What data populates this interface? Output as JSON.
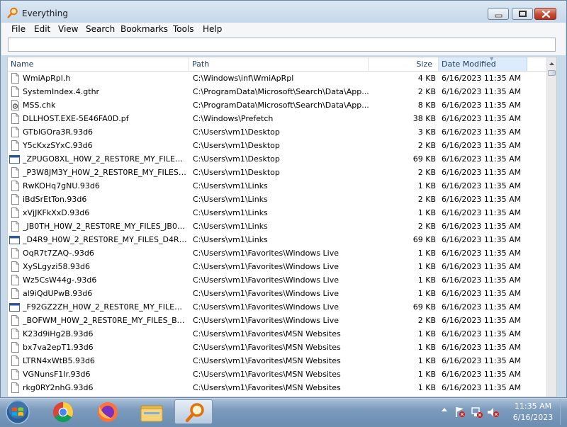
{
  "window": {
    "title": "Everything"
  },
  "menu": [
    "File",
    "Edit",
    "View",
    "Search",
    "Bookmarks",
    "Tools",
    "Help"
  ],
  "search": {
    "value": ""
  },
  "columns": {
    "name": "Name",
    "path": "Path",
    "size": "Size",
    "date": "Date Modified"
  },
  "files": [
    {
      "icon": "doc",
      "name": "WmiApRpl.h",
      "path": "C:\\Windows\\inf\\WmiApRpl",
      "size": "4 KB",
      "date": "6/16/2023 11:35 AM"
    },
    {
      "icon": "doc",
      "name": "SystemIndex.4.gthr",
      "path": "C:\\ProgramData\\Microsoft\\Search\\Data\\App...",
      "size": "2 KB",
      "date": "6/16/2023 11:35 AM"
    },
    {
      "icon": "gear",
      "name": "MSS.chk",
      "path": "C:\\ProgramData\\Microsoft\\Search\\Data\\App...",
      "size": "8 KB",
      "date": "6/16/2023 11:35 AM"
    },
    {
      "icon": "doc",
      "name": "DLLHOST.EXE-5E46FA0D.pf",
      "path": "C:\\Windows\\Prefetch",
      "size": "38 KB",
      "date": "6/16/2023 11:35 AM"
    },
    {
      "icon": "doc",
      "name": "GTblGOra3R.93d6",
      "path": "C:\\Users\\vm1\\Desktop",
      "size": "3 KB",
      "date": "6/16/2023 11:35 AM"
    },
    {
      "icon": "doc",
      "name": "Y5cKxzSYxC.93d6",
      "path": "C:\\Users\\vm1\\Desktop",
      "size": "2 KB",
      "date": "6/16/2023 11:35 AM"
    },
    {
      "icon": "window",
      "name": "_ZPUGO8XL_H0W_2_REST0RE_MY_FILES_Z...",
      "path": "C:\\Users\\vm1\\Desktop",
      "size": "69 KB",
      "date": "6/16/2023 11:35 AM"
    },
    {
      "icon": "doc",
      "name": "_P3W8JM3Y_H0W_2_REST0RE_MY_FILES_P...",
      "path": "C:\\Users\\vm1\\Desktop",
      "size": "2 KB",
      "date": "6/16/2023 11:35 AM"
    },
    {
      "icon": "doc",
      "name": "RwKOHq7gNU.93d6",
      "path": "C:\\Users\\vm1\\Links",
      "size": "1 KB",
      "date": "6/16/2023 11:35 AM"
    },
    {
      "icon": "doc",
      "name": "iBdSrEtTon.93d6",
      "path": "C:\\Users\\vm1\\Links",
      "size": "2 KB",
      "date": "6/16/2023 11:35 AM"
    },
    {
      "icon": "doc",
      "name": "xVjJKFkXxD.93d6",
      "path": "C:\\Users\\vm1\\Links",
      "size": "1 KB",
      "date": "6/16/2023 11:35 AM"
    },
    {
      "icon": "doc",
      "name": "_JB0TH_H0W_2_REST0RE_MY_FILES_JB0TH...",
      "path": "C:\\Users\\vm1\\Links",
      "size": "2 KB",
      "date": "6/16/2023 11:35 AM"
    },
    {
      "icon": "window",
      "name": "_D4R9_H0W_2_REST0RE_MY_FILES_D4R9_...",
      "path": "C:\\Users\\vm1\\Links",
      "size": "69 KB",
      "date": "6/16/2023 11:35 AM"
    },
    {
      "icon": "doc",
      "name": "OqR7t7ZAQ-.93d6",
      "path": "C:\\Users\\vm1\\Favorites\\Windows Live",
      "size": "1 KB",
      "date": "6/16/2023 11:35 AM"
    },
    {
      "icon": "doc",
      "name": "XySLgyzi58.93d6",
      "path": "C:\\Users\\vm1\\Favorites\\Windows Live",
      "size": "1 KB",
      "date": "6/16/2023 11:35 AM"
    },
    {
      "icon": "doc",
      "name": "Wz5CsW44g-.93d6",
      "path": "C:\\Users\\vm1\\Favorites\\Windows Live",
      "size": "1 KB",
      "date": "6/16/2023 11:35 AM"
    },
    {
      "icon": "doc",
      "name": "al9iQdUPwB.93d6",
      "path": "C:\\Users\\vm1\\Favorites\\Windows Live",
      "size": "1 KB",
      "date": "6/16/2023 11:35 AM"
    },
    {
      "icon": "window",
      "name": "_F92GZ2ZH_H0W_2_REST0RE_MY_FILES_F...",
      "path": "C:\\Users\\vm1\\Favorites\\Windows Live",
      "size": "69 KB",
      "date": "6/16/2023 11:35 AM"
    },
    {
      "icon": "doc",
      "name": "_BOFWM_H0W_2_REST0RE_MY_FILES_BOF...",
      "path": "C:\\Users\\vm1\\Favorites\\Windows Live",
      "size": "2 KB",
      "date": "6/16/2023 11:35 AM"
    },
    {
      "icon": "doc",
      "name": "K23d9iHg2B.93d6",
      "path": "C:\\Users\\vm1\\Favorites\\MSN Websites",
      "size": "1 KB",
      "date": "6/16/2023 11:35 AM"
    },
    {
      "icon": "doc",
      "name": "bx7va2epT1.93d6",
      "path": "C:\\Users\\vm1\\Favorites\\MSN Websites",
      "size": "1 KB",
      "date": "6/16/2023 11:35 AM"
    },
    {
      "icon": "doc",
      "name": "LTRN4xWtB5.93d6",
      "path": "C:\\Users\\vm1\\Favorites\\MSN Websites",
      "size": "1 KB",
      "date": "6/16/2023 11:35 AM"
    },
    {
      "icon": "doc",
      "name": "VGNunsF1Ir.93d6",
      "path": "C:\\Users\\vm1\\Favorites\\MSN Websites",
      "size": "1 KB",
      "date": "6/16/2023 11:35 AM"
    },
    {
      "icon": "doc",
      "name": "rkg0RY2nhG.93d6",
      "path": "C:\\Users\\vm1\\Favorites\\MSN Websites",
      "size": "1 KB",
      "date": "6/16/2023 11:35 AM"
    }
  ],
  "taskbar": {
    "items": [
      "start-orb",
      "chrome-icon",
      "firefox-icon",
      "file-explorer-icon",
      "everything-search-icon"
    ],
    "clock_time": "11:35 AM",
    "clock_date": "6/16/2023"
  }
}
